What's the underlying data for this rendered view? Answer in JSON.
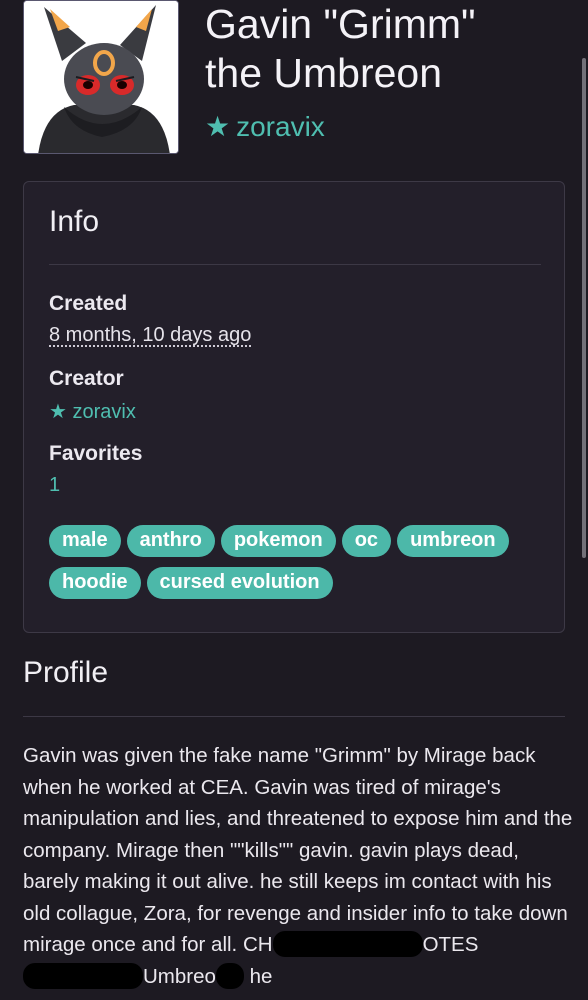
{
  "character": {
    "name": "Gavin \"Grimm\" the Umbreon",
    "owner": "zoravix"
  },
  "info": {
    "heading": "Info",
    "created_label": "Created",
    "created_value": "8 months, 10 days ago",
    "creator_label": "Creator",
    "creator_value": "zoravix",
    "favorites_label": "Favorites",
    "favorites_value": "1",
    "tags": [
      "male",
      "anthro",
      "pokemon",
      "oc",
      "umbreon",
      "hoodie",
      "cursed evolution"
    ]
  },
  "profile": {
    "heading": "Profile",
    "paragraph": "Gavin was given the fake name \"Grimm\" by Mirage back when he worked at CEA. Gavin was tired of mirage's manipulation and lies, and threatened to expose him and the company. Mirage then \"\"kills\"\" gavin. gavin plays dead, barely making it out alive. he still keeps im contact with his old collague, Zora, for revenge and insider info to take down mirage once and",
    "tail_start": "for all. CH",
    "tail_mid": "OTES",
    "tail_end_a": "Umbreo",
    "tail_end_b": "he"
  },
  "colors": {
    "background": "#1d1a22",
    "card": "#231f2a",
    "accent": "#4fbeb0",
    "tag": "#4cb8a9"
  }
}
